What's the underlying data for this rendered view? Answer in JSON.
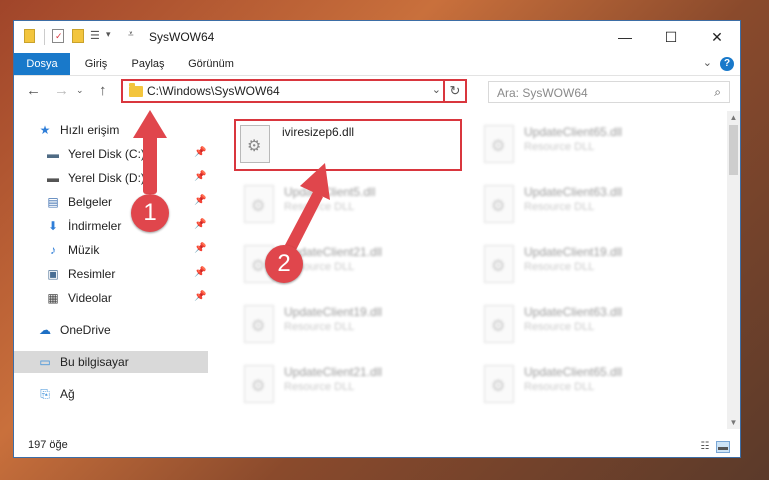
{
  "window": {
    "title": "SysWOW64",
    "minimize_glyph": "—",
    "maximize_glyph": "☐",
    "close_glyph": "✕"
  },
  "quick_access_toolbar": {
    "icons": [
      "folder-icon",
      "properties-icon",
      "new-folder-icon",
      "customize-icon"
    ],
    "dropdown_glyph": "▾"
  },
  "ribbon": {
    "tabs": [
      "Dosya",
      "Giriş",
      "Paylaş",
      "Görünüm"
    ],
    "expand_glyph": "⌄",
    "help_glyph": "?"
  },
  "address_bar": {
    "path": "C:\\Windows\\SysWOW64",
    "back_glyph": "←",
    "forward_glyph": "→",
    "up_glyph": "↑",
    "dropdown_glyph": "⌄",
    "refresh_glyph": "↻"
  },
  "search": {
    "placeholder": "Ara: SysWOW64",
    "icon_glyph": "⌕"
  },
  "navigation": {
    "items": [
      {
        "label": "Hızlı erişim",
        "icon": "star-icon",
        "glyph": "★",
        "color": "#2f7ed8"
      },
      {
        "label": "Yerel Disk (C:)",
        "icon": "drive-icon",
        "glyph": "▬",
        "color": "#4f6b84",
        "pinned": true
      },
      {
        "label": "Yerel Disk (D:)",
        "icon": "drive-icon",
        "glyph": "▬",
        "color": "#555555",
        "pinned": true
      },
      {
        "label": "Belgeler",
        "icon": "documents-icon",
        "glyph": "▤",
        "color": "#3e6fb0",
        "pinned": true
      },
      {
        "label": "İndirmeler",
        "icon": "downloads-icon",
        "glyph": "⬇",
        "color": "#2f7ed8",
        "pinned": true
      },
      {
        "label": "Müzik",
        "icon": "music-icon",
        "glyph": "♪",
        "color": "#2f7ed8",
        "pinned": true
      },
      {
        "label": "Resimler",
        "icon": "pictures-icon",
        "glyph": "▣",
        "color": "#4a6f95",
        "pinned": true
      },
      {
        "label": "Videolar",
        "icon": "videos-icon",
        "glyph": "▦",
        "color": "#444444",
        "pinned": true
      },
      {
        "label": "OneDrive",
        "icon": "onedrive-icon",
        "glyph": "☁",
        "color": "#1d6fc4"
      },
      {
        "label": "Bu bilgisayar",
        "icon": "computer-icon",
        "glyph": "▭",
        "color": "#3b8fd9",
        "selected": true
      },
      {
        "label": "Ağ",
        "icon": "network-icon",
        "glyph": "⎘",
        "color": "#3b8fd9"
      }
    ],
    "pin_glyph": "📌"
  },
  "files": [
    {
      "name": "iviresizep6.dll",
      "type": "",
      "highlighted": true
    },
    {
      "name": "UpdateClient65.dll",
      "type": "Resource DLL"
    },
    {
      "name": "UpdateClient5.dll",
      "type": "Resource DLL"
    },
    {
      "name": "UpdateClient63.dll",
      "type": "Resource DLL"
    },
    {
      "name": "UpdateClient21.dll",
      "type": "Resource DLL"
    },
    {
      "name": "UpdateClient19.dll",
      "type": "Resource DLL"
    },
    {
      "name": "UpdateClient19.dll",
      "type": "Resource DLL"
    },
    {
      "name": "UpdateClient63.dll",
      "type": "Resource DLL"
    },
    {
      "name": "UpdateClient21.dll",
      "type": "Resource DLL"
    },
    {
      "name": "UpdateClient65.dll",
      "type": "Resource DLL"
    }
  ],
  "status": {
    "item_count": "197 öğe"
  },
  "callouts": [
    "1",
    "2"
  ],
  "colors": {
    "accent": "#1979ca",
    "highlight_border": "#d9363e",
    "callout": "#e0464c"
  }
}
